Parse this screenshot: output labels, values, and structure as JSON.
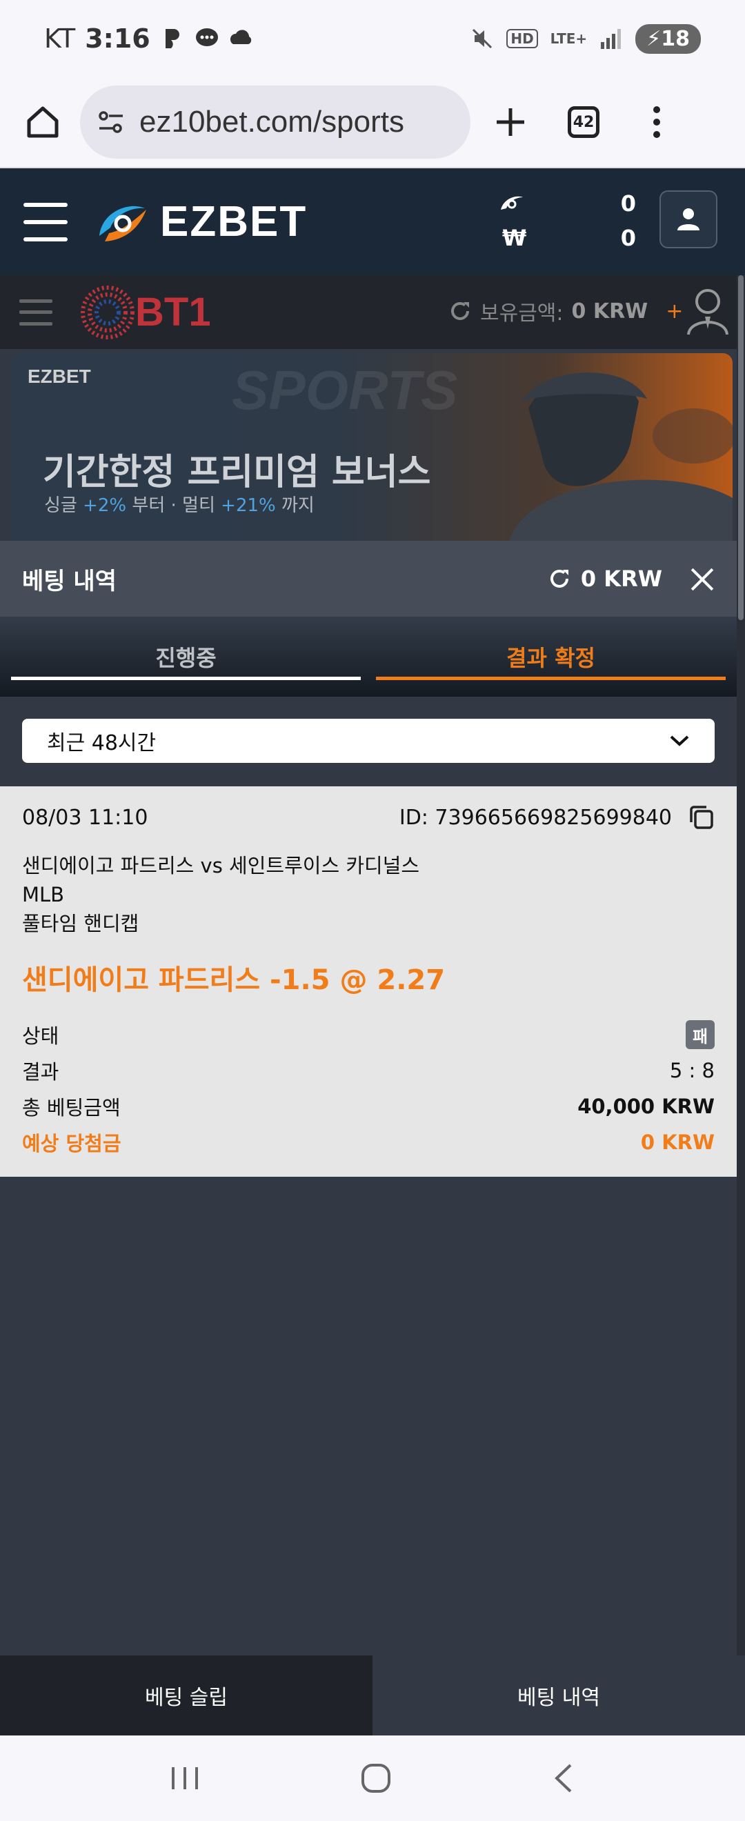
{
  "status_bar": {
    "carrier": "KT",
    "time": "3:16",
    "battery": "18"
  },
  "browser": {
    "url": "ez10bet.com/sports",
    "tab_count": "42"
  },
  "site_header": {
    "logo_text": "EZBET",
    "balance_top": "0",
    "currency_symbol": "₩",
    "balance_krw": "0"
  },
  "sub_header": {
    "logo_text": "BT1",
    "balance_label": "보유금액:",
    "balance_value": "0 KRW",
    "plus": "+"
  },
  "banner": {
    "logo_text": "EZBET",
    "watermark": "SPORTS",
    "title": "기간한정 프리미엄 보너스",
    "sub_single": "싱글",
    "sub_single_pct": "+2%",
    "sub_from": "부터 · 멀티",
    "sub_multi_pct": "+21%",
    "sub_to": "까지"
  },
  "panel": {
    "title": "베팅 내역",
    "balance": "0 KRW",
    "tabs": [
      {
        "label": "진행중",
        "active": false
      },
      {
        "label": "결과 확정",
        "active": true
      }
    ],
    "filter": {
      "selected": "최근 48시간"
    }
  },
  "bet": {
    "date": "08/03 11:10",
    "id": "ID: 739665669825699840",
    "match": "샌디에이고 파드리스 vs 세인트루이스 카디널스",
    "league": "MLB",
    "market": "풀타임 핸디캡",
    "pick": "샌디에이고 파드리스 -1.5 @ 2.27",
    "status_label": "상태",
    "status_value": "패",
    "result_label": "결과",
    "result_value": "5 : 8",
    "stake_label": "총 베팅금액",
    "stake_value": "40,000 KRW",
    "payout_label": "예상 당첨금",
    "payout_value": "0 KRW"
  },
  "bottom_tabs": {
    "slip": "베팅 슬립",
    "history": "베팅 내역"
  },
  "colors": {
    "accent": "#f07d1a",
    "header_bg": "#1b2838",
    "panel_bg": "#333845"
  }
}
